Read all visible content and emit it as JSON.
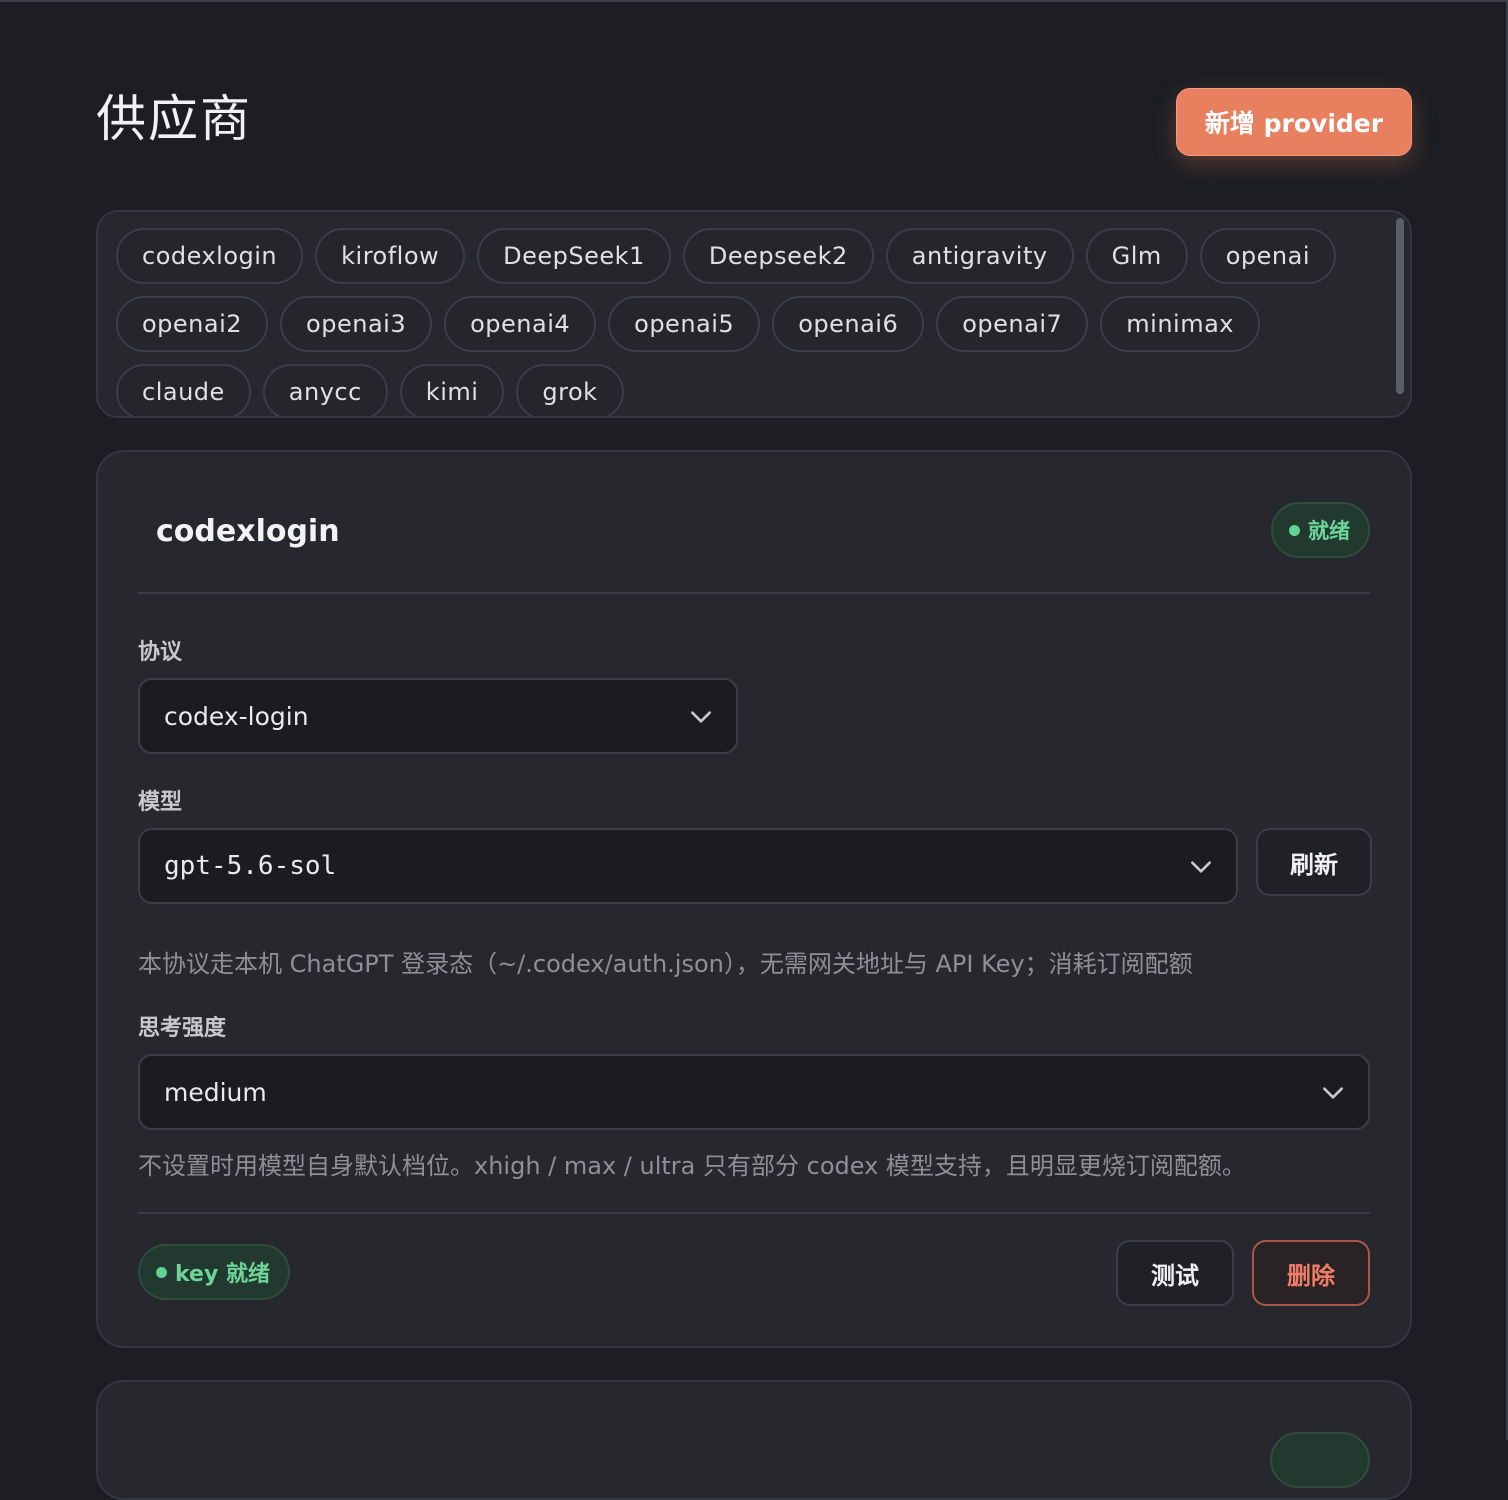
{
  "header": {
    "title": "供应商",
    "add_button_label": "新增 provider",
    "colors": {
      "accent": "#e8805f",
      "success": "#5fd391",
      "danger": "#f07d66"
    }
  },
  "providers": [
    "codexlogin",
    "kiroflow",
    "DeepSeek1",
    "Deepseek2",
    "antigravity",
    "Glm",
    "openai",
    "openai2",
    "openai3",
    "openai4",
    "openai5",
    "openai6",
    "openai7",
    "minimax",
    "claude",
    "anycc",
    "kimi",
    "grok"
  ],
  "card": {
    "name": "codexlogin",
    "status": "就绪",
    "protocol_label": "协议",
    "protocol_value": "codex-login",
    "model_label": "模型",
    "model_value": "gpt-5.6-sol",
    "refresh_label": "刷新",
    "protocol_hint": "本协议走本机 ChatGPT 登录态（~/.codex/auth.json），无需网关地址与 API Key；消耗订阅配额",
    "effort_label": "思考强度",
    "effort_value": "medium",
    "effort_hint": "不设置时用模型自身默认档位。xhigh / max / ultra 只有部分 codex 模型支持，且明显更烧订阅配额。",
    "key_status": "key 就绪",
    "test_label": "测试",
    "delete_label": "删除"
  },
  "icons": {
    "dropdown": "chevron-down-icon",
    "status": "status-dot-icon"
  }
}
